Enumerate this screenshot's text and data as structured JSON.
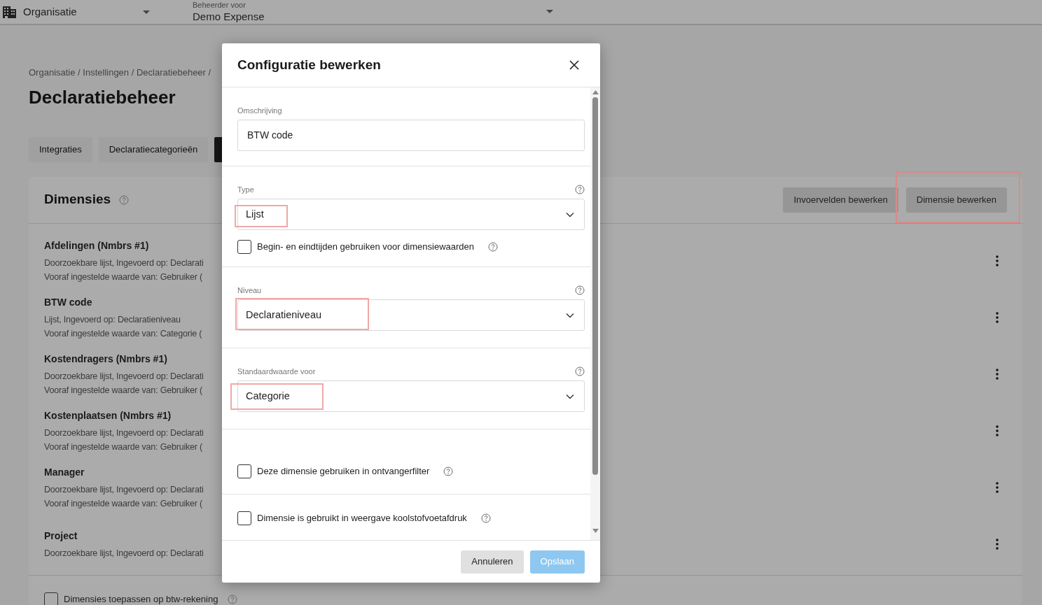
{
  "topbar": {
    "organisation": "Organisatie",
    "manager_label": "Beheerder voor",
    "manager_value": "Demo Expense"
  },
  "breadcrumb": "Organisatie / Instellingen / Declaratiebeheer /",
  "page_title": "Declaratiebeheer",
  "tabs": [
    {
      "label": "Integraties",
      "selected": false
    },
    {
      "label": "Declaratiecategorieën",
      "selected": false
    },
    {
      "selected": true
    }
  ],
  "dimensions": {
    "title": "Dimensies",
    "buttons": [
      {
        "label": "Invoervelden bewerken",
        "highlighted": false
      },
      {
        "label": "Dimensie bewerken",
        "highlighted": true
      }
    ],
    "items": [
      {
        "name": "Afdelingen (Nmbrs #1)",
        "lines": [
          "Doorzoekbare lijst, Ingevoerd op: Declarati",
          "Vooraf ingestelde waarde van: Gebruiker ("
        ]
      },
      {
        "name": "BTW code",
        "lines": [
          "Lijst, Ingevoerd op: Declaratieniveau",
          "Vooraf ingestelde waarde van: Categorie ("
        ]
      },
      {
        "name": "Kostendragers (Nmbrs #1)",
        "lines": [
          "Doorzoekbare lijst, Ingevoerd op: Declarati",
          "Vooraf ingestelde waarde van: Gebruiker ("
        ]
      },
      {
        "name": "Kostenplaatsen (Nmbrs #1)",
        "lines": [
          "Doorzoekbare lijst, Ingevoerd op: Declarati",
          "Vooraf ingestelde waarde van: Gebruiker ("
        ]
      },
      {
        "name": "Manager",
        "lines": [
          "Doorzoekbare lijst, Ingevoerd op: Declarati",
          "Vooraf ingestelde waarde van: Gebruiker ("
        ]
      },
      {
        "name": "Project",
        "lines": [
          "Doorzoekbare lijst, Ingevoerd op: Declarati"
        ]
      }
    ],
    "footer_checkbox": {
      "label": "Dimensies toepassen op btw-rekening",
      "checked": false
    }
  },
  "dialog": {
    "title": "Configuratie bewerken",
    "sections": [
      {
        "kind": "text",
        "label": "Omschrijving",
        "value": "BTW code"
      },
      {
        "kind": "select",
        "label": "Type",
        "value": "Lijst",
        "highlighted": true,
        "checkbox": {
          "label": "Begin- en eindtijden gebruiken voor dimensiewaarden",
          "checked": false
        }
      },
      {
        "kind": "select",
        "label": "Niveau",
        "value": "Declaratieniveau",
        "highlighted": true
      },
      {
        "kind": "select",
        "label": "Standaardwaarde voor",
        "value": "Categorie",
        "highlighted": true
      },
      {
        "kind": "checkbox",
        "label": "Deze dimensie gebruiken in ontvangerfilter",
        "checked": false
      },
      {
        "kind": "checkbox",
        "label": "Dimensie is gebruikt in weergave koolstofvoetafdruk",
        "checked": false
      }
    ],
    "buttons": [
      {
        "label": "Annuleren",
        "kind": "secondary",
        "disabled": false
      },
      {
        "label": "Opslaan",
        "kind": "primary",
        "disabled": true
      }
    ]
  }
}
